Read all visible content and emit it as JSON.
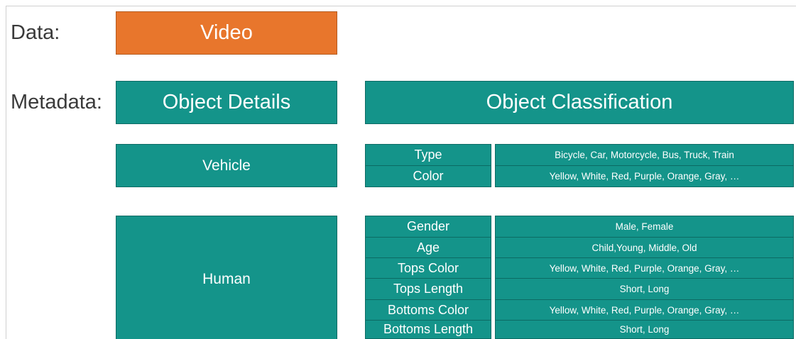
{
  "labels": {
    "data": "Data:",
    "metadata": "Metadata:"
  },
  "data_box": "Video",
  "headers": {
    "object_details": "Object Details",
    "object_classification": "Object Classification"
  },
  "vehicle": {
    "name": "Vehicle",
    "attributes": [
      {
        "name": "Type",
        "values": "Bicycle, Car, Motorcycle, Bus, Truck, Train"
      },
      {
        "name": "Color",
        "values": "Yellow, White, Red, Purple, Orange, Gray, …"
      }
    ]
  },
  "human": {
    "name": "Human",
    "attributes": [
      {
        "name": "Gender",
        "values": "Male, Female"
      },
      {
        "name": "Age",
        "values": "Child,Young, Middle, Old"
      },
      {
        "name": "Tops Color",
        "values": "Yellow, White, Red, Purple, Orange, Gray, …"
      },
      {
        "name": "Tops Length",
        "values": "Short, Long"
      },
      {
        "name": "Bottoms Color",
        "values": "Yellow, White, Red, Purple, Orange, Gray, …"
      },
      {
        "name": "Bottoms Length",
        "values": "Short, Long"
      }
    ]
  },
  "colors": {
    "orange": "#e8762c",
    "teal": "#14948a",
    "label_text": "#3a3a3a"
  }
}
